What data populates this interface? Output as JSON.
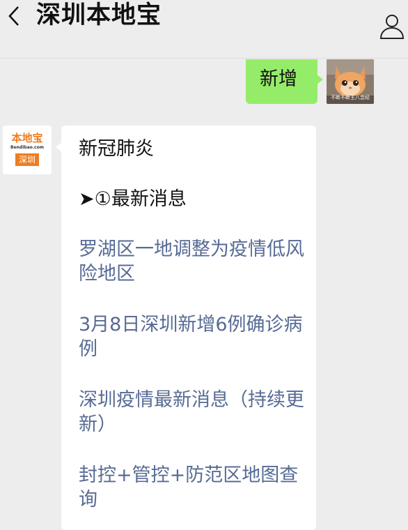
{
  "header": {
    "title": "深圳本地宝"
  },
  "user_message": {
    "text": "新增"
  },
  "user_avatar": {
    "caption": "不断不断王八念经"
  },
  "bot_avatar": {
    "logo_text": "本地宝",
    "logo_url": "Bendibao.com",
    "city": "深圳"
  },
  "bot_message": {
    "heading": "新冠肺炎",
    "subheading": "➤①最新消息",
    "links": [
      "罗湖区一地调整为疫情低风险地区",
      "3月8日深圳新增6例确诊病例",
      "深圳疫情最新消息（持续更新）",
      "封控+管控+防范区地图查询"
    ]
  },
  "colors": {
    "background": "#ededed",
    "user_bubble": "#95ec69",
    "bot_bubble": "#ffffff",
    "link": "#576b95",
    "brand_orange": "#f07c1e"
  },
  "icons": {
    "back": "chevron-left-icon",
    "profile": "person-outline-icon"
  }
}
